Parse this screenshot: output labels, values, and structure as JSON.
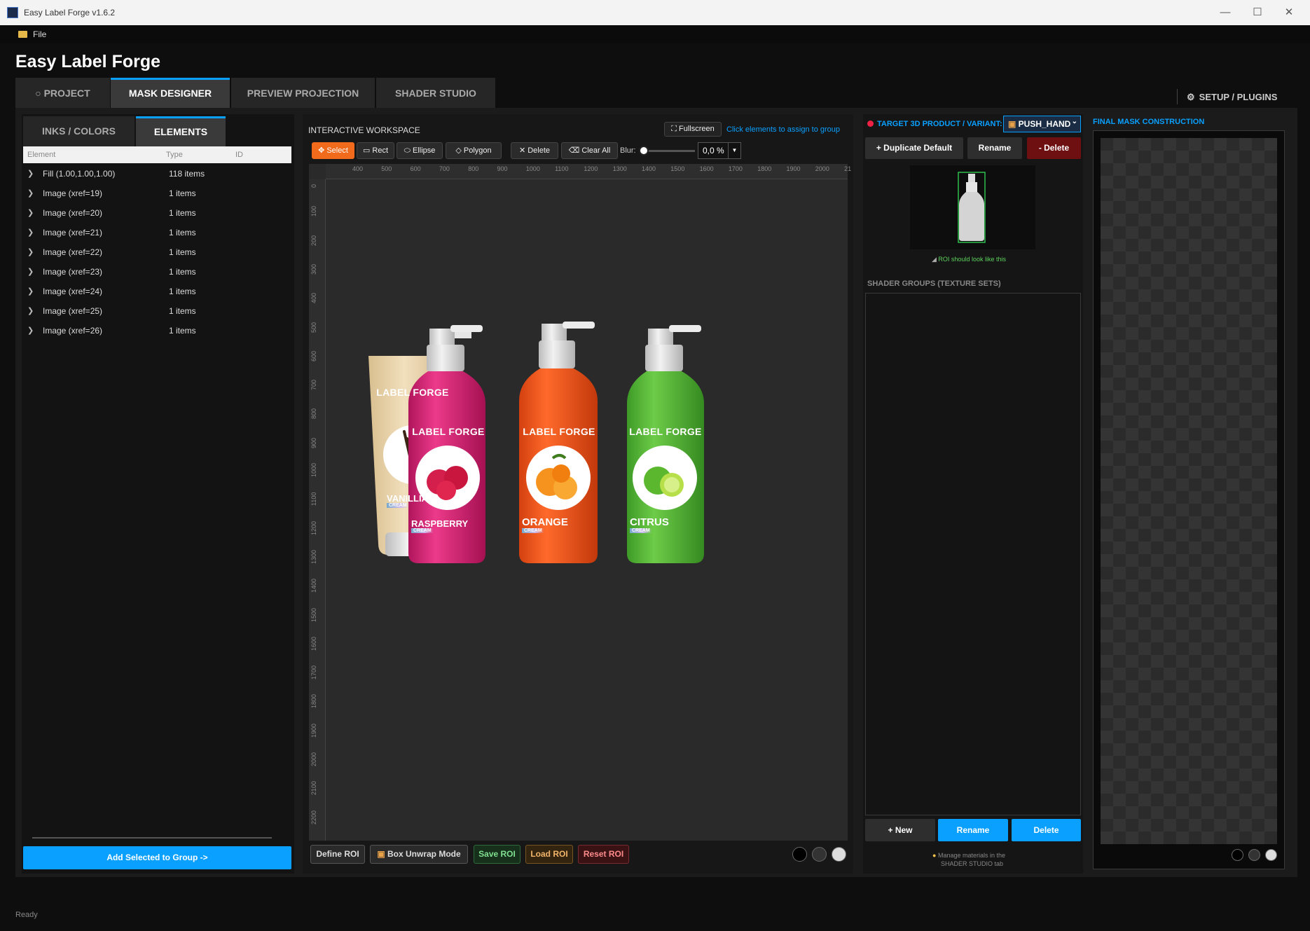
{
  "window": {
    "title": "Easy Label Forge v1.6.2"
  },
  "menu": {
    "file": "File"
  },
  "app_title": "Easy Label Forge",
  "main_tabs": [
    {
      "label": "○ PROJECT"
    },
    {
      "label": "MASK DESIGNER"
    },
    {
      "label": "PREVIEW PROJECTION"
    },
    {
      "label": "SHADER STUDIO"
    }
  ],
  "setup": "SETUP / PLUGINS",
  "sub_tabs": [
    {
      "label": "INKS / COLORS"
    },
    {
      "label": "ELEMENTS"
    }
  ],
  "table": {
    "columns": [
      "Element",
      "Type",
      "ID"
    ],
    "rows": [
      {
        "name": "Fill (1.00,1.00,1.00)",
        "count": "118 items"
      },
      {
        "name": "Image (xref=19)",
        "count": "1 items"
      },
      {
        "name": "Image (xref=20)",
        "count": "1 items"
      },
      {
        "name": "Image (xref=21)",
        "count": "1 items"
      },
      {
        "name": "Image (xref=22)",
        "count": "1 items"
      },
      {
        "name": "Image (xref=23)",
        "count": "1 items"
      },
      {
        "name": "Image (xref=24)",
        "count": "1 items"
      },
      {
        "name": "Image (xref=25)",
        "count": "1 items"
      },
      {
        "name": "Image (xref=26)",
        "count": "1 items"
      }
    ]
  },
  "add_selected": "Add Selected to Group ->",
  "workspace": {
    "label": "INTERACTIVE WORKSPACE",
    "fullscreen": "Fullscreen",
    "hint": "Click elements to assign to group",
    "tools": {
      "select": "Select",
      "rect": "Rect",
      "ellipse": "Ellipse",
      "polygon": "Polygon",
      "delete": "Delete",
      "clear_all": "Clear All"
    },
    "blur_label": "Blur:",
    "blur_value": "0,0 %",
    "ruler_h": [
      "400",
      "500",
      "600",
      "700",
      "800",
      "900",
      "1000",
      "1100",
      "1200",
      "1300",
      "1400",
      "1500",
      "1600",
      "1700",
      "1800",
      "1900",
      "2000",
      "21"
    ],
    "ruler_v": [
      "0",
      "100",
      "200",
      "300",
      "400",
      "500",
      "600",
      "700",
      "800",
      "900",
      "1000",
      "1100",
      "1200",
      "1300",
      "1400",
      "1500",
      "1600",
      "1700",
      "1800",
      "1900",
      "2000",
      "2100",
      "2200"
    ],
    "products": [
      {
        "brand": "LABEL FORGE",
        "name": "VANILLIA",
        "sub": "CREAM"
      },
      {
        "brand": "LABEL FORGE",
        "name": "RASPBERRY",
        "sub": "CREAM"
      },
      {
        "brand": "LABEL FORGE",
        "name": "ORANGE",
        "sub": "CREAM"
      },
      {
        "brand": "LABEL FORGE",
        "name": "CITRUS",
        "sub": "CREAM"
      }
    ],
    "bottom": {
      "define_roi": "Define ROI",
      "box_unwrap": "Box Unwrap Mode",
      "save_roi": "Save ROI",
      "load_roi": "Load ROI",
      "reset_roi": "Reset ROI"
    }
  },
  "target": {
    "label": "TARGET 3D PRODUCT / VARIANT:",
    "variant": "PUSH_HAND",
    "duplicate": "+ Duplicate Default",
    "rename": "Rename",
    "delete": "- Delete",
    "roi_hint": "ROI should look like this"
  },
  "shader_groups": {
    "label": "SHADER GROUPS (TEXTURE SETS)",
    "new": "+ New",
    "rename": "Rename",
    "delete": "Delete",
    "manage_hint_1": "Manage materials in the",
    "manage_hint_2": "SHADER STUDIO tab"
  },
  "final_mask": {
    "label": "FINAL MASK CONSTRUCTION"
  },
  "status": "Ready",
  "colors": {
    "accent": "#0aa0ff",
    "select_active": "#f26a1b",
    "delete_red": "#6e0f12",
    "green_hint": "#5dd35d"
  }
}
